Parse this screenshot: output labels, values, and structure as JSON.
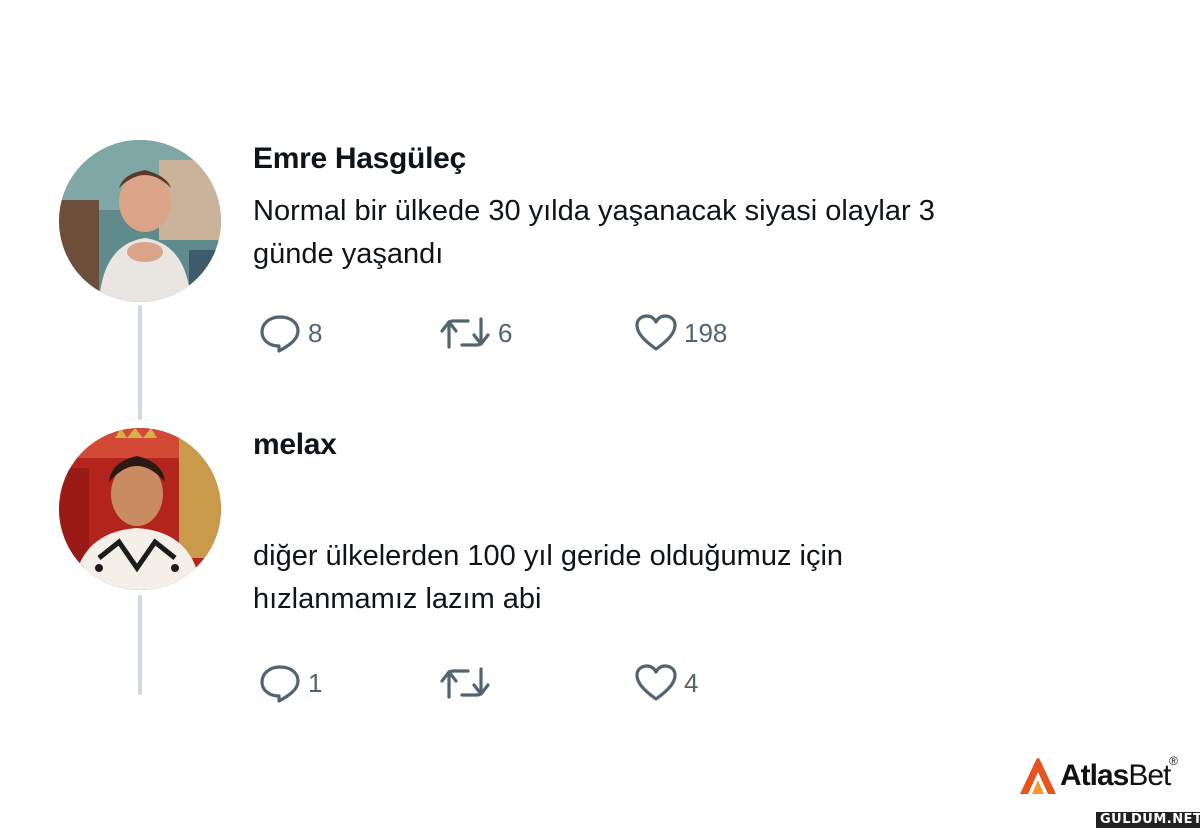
{
  "tweets": [
    {
      "author": "Emre Hasgüleç",
      "text_lines": [
        "Normal bir ülkede 30 yılda yaşanacak siyasi olaylar 3",
        "günde yaşandı"
      ],
      "replies": "8",
      "retweets": "6",
      "likes": "198"
    },
    {
      "author": "melax",
      "text_lines": [
        "diğer ülkelerden 100 yıl geride olduğumuz için",
        "hızlanmamız lazım abi"
      ],
      "replies": "1",
      "retweets": "",
      "likes": "4"
    }
  ],
  "icons": {
    "reply": "reply-icon",
    "retweet": "retweet-icon",
    "like": "heart-icon"
  },
  "colors": {
    "text": "#0f1419",
    "icon": "#536471",
    "thread_line": "#cfd9de",
    "brand_accent": "#e8531e"
  },
  "brand": {
    "atlas": "Atlas",
    "bet": "Bet",
    "reg": "®"
  },
  "watermark": "GULDUM.NET"
}
